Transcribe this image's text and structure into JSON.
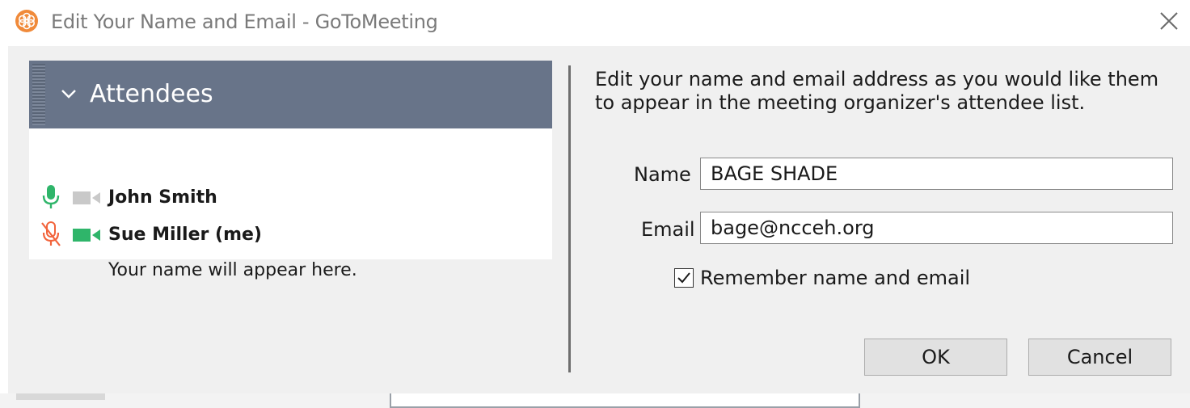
{
  "window": {
    "title": "Edit Your Name and Email - GoToMeeting",
    "app_icon": "gotomeeting-logo-icon",
    "close_icon": "close-icon"
  },
  "preview": {
    "header_title": "Attendees",
    "chevron_icon": "chevron-down-icon",
    "attendees": [
      {
        "name": "John Smith",
        "mic_icon": "microphone-icon",
        "mic_state": "active",
        "cam_icon": "camera-icon",
        "cam_state": "off"
      },
      {
        "name": "Sue Miller (me)",
        "mic_icon": "microphone-muted-icon",
        "mic_state": "muted",
        "cam_icon": "camera-icon",
        "cam_state": "on"
      }
    ],
    "placeholder_line": "Your name will appear here."
  },
  "form": {
    "instructions": "Edit your name and email address as you would like them to appear in the meeting organizer's attendee list.",
    "name_label": "Name",
    "name_value": "BAGE SHADE",
    "email_label": "Email",
    "email_value": "bage@ncceh.org",
    "remember_label": "Remember name and email",
    "remember_checked": true,
    "ok_label": "OK",
    "cancel_label": "Cancel"
  },
  "colors": {
    "header_bg": "#687489",
    "mic_active": "#2fb56a",
    "mic_muted": "#f2643c",
    "cam_on": "#2fb56a",
    "cam_off": "#c9c9c9",
    "app_icon": "#f08a3a"
  }
}
